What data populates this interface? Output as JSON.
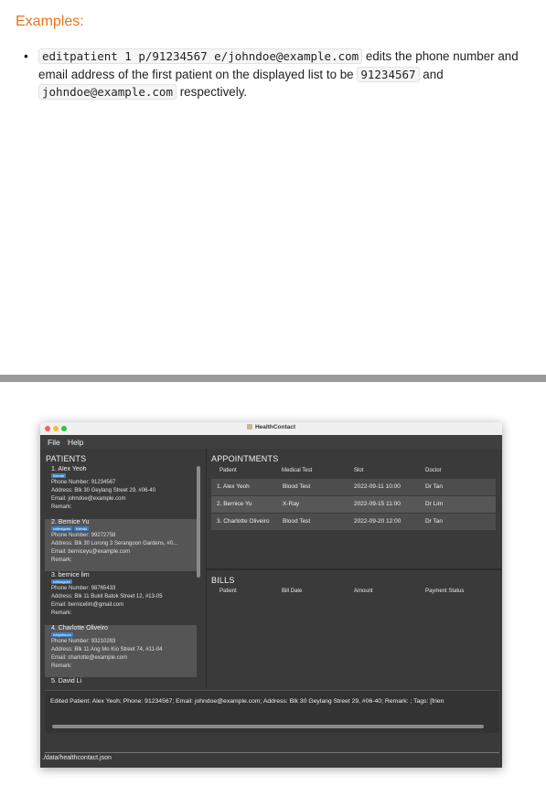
{
  "doc": {
    "heading": "Examples:",
    "example": {
      "cmd": "editpatient 1 p/91234567 e/johndoe@example.com",
      "text1": " edits the phone number and email address of the first patient on the displayed list to be ",
      "phone": "91234567",
      "text2": " and ",
      "email": "johndoe@example.com",
      "text3": " respectively."
    }
  },
  "app": {
    "title": "HealthContact",
    "menu": {
      "file": "File",
      "help": "Help"
    },
    "colors": {
      "close": "#fc5f57",
      "minimize": "#fdbc2e",
      "zoom": "#28c840",
      "tag": "#3d7fc7"
    },
    "patients": {
      "title": "PATIENTS",
      "items": [
        {
          "name": "1.  Alex Yeoh",
          "tags": [
            "friends"
          ],
          "phone": "Phone Number: 91234567",
          "address": "Address: Blk 30 Geylang Street 29, #06-40",
          "email": "Email: johndoe@example.com",
          "remark": "Remark:"
        },
        {
          "name": "2.  Bernice Yu",
          "tags": [
            "colleagues",
            "friends"
          ],
          "phone": "Phone Number: 99272758",
          "address": "Address: Blk 30 Lorong 3 Serangoon Gardens, #0...",
          "email": "Email: berniceyu@example.com",
          "remark": "Remark:"
        },
        {
          "name": "3.  bernice lim",
          "tags": [
            "colleagues"
          ],
          "phone": "Phone Number: 98765433",
          "address": "Address: Blk 11 Bukit Batok Street 12, #13-05",
          "email": "Email: bernicelim@gmail.com",
          "remark": "Remark:"
        },
        {
          "name": "4.  Charlotte Oliveiro",
          "tags": [
            "neighbours"
          ],
          "phone": "Phone Number: 93210283",
          "address": "Address: Blk 11 Ang Mo Kio Street 74, #11-04",
          "email": "Email: charlotte@example.com",
          "remark": "Remark:"
        },
        {
          "name": "5.  David Li",
          "tags": [],
          "phone": "",
          "address": "",
          "email": "",
          "remark": ""
        }
      ]
    },
    "appointments": {
      "title": "APPOINTMENTS",
      "headers": {
        "patient": "Patient",
        "test": "Medical Test",
        "slot": "Slot",
        "doctor": "Doctor"
      },
      "rows": [
        {
          "patient": "1.  Alex Yeoh",
          "test": "Blood Test",
          "slot": "2022-09-11 10:00",
          "doctor": "Dr Tan"
        },
        {
          "patient": "2.  Bernice Yu",
          "test": "X-Ray",
          "slot": "2022-09-15 11:00",
          "doctor": "Dr Lim"
        },
        {
          "patient": "3.  Charlotte Oliveiro",
          "test": "Blood Test",
          "slot": "2022-09-20 12:00",
          "doctor": "Dr Tan"
        }
      ]
    },
    "bills": {
      "title": "BILLS",
      "headers": {
        "patient": "Patient",
        "date": "Bill Date",
        "amount": "Amount",
        "status": "Payment Status"
      }
    },
    "result": "Edited Patient: Alex Yeoh; Phone: 91234567; Email: johndoe@example.com; Address: Blk 30 Geylang Street 29, #06-40; Remark: ; Tags: [frien",
    "status": "./data/healthcontact.json"
  }
}
